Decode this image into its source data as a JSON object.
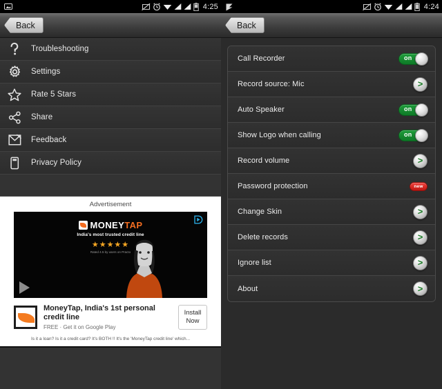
{
  "left_screen": {
    "status_bar": {
      "clock": "4:25",
      "icons": [
        "screenshot-icon",
        "alarm-icon",
        "wifi-icon",
        "signal-icon",
        "signal-2-icon",
        "battery-icon"
      ]
    },
    "action_bar": {
      "back_label": "Back"
    },
    "menu": {
      "items": [
        {
          "label": "Troubleshooting",
          "icon": "question-mark-icon"
        },
        {
          "label": "Settings",
          "icon": "gear-icon"
        },
        {
          "label": "Rate 5 Stars",
          "icon": "star-icon"
        },
        {
          "label": "Share",
          "icon": "share-icon"
        },
        {
          "label": "Feedback",
          "icon": "envelope-icon"
        },
        {
          "label": "Privacy Policy",
          "icon": "document-icon"
        }
      ]
    },
    "advertisement": {
      "label": "Advertisement",
      "brand_primary": "MONEY",
      "brand_secondary": "TAP",
      "tagline": "India's most trusted credit line",
      "stars": "★★★★★",
      "rating_note": "Rated 4.5 by users on Practo",
      "app_title": "MoneyTap, India's 1st personal credit line",
      "app_subtitle": "FREE · Get it on Google Play",
      "install_line1": "Install",
      "install_line2": "Now",
      "description": "Is it a loan? Is it a credit card? It's BOTH !!  It's the 'MoneyTap credit line' which...",
      "adchoices_icon": "adchoices-icon",
      "play_icon": "play-icon"
    }
  },
  "right_screen": {
    "status_bar": {
      "clock": "4:24",
      "icons": [
        "screenshot-icon",
        "alarm-icon",
        "wifi-icon",
        "signal-icon",
        "signal-2-icon",
        "battery-icon"
      ]
    },
    "action_bar": {
      "back_label": "Back"
    },
    "settings": {
      "rows": [
        {
          "label": "Call Recorder",
          "control": "toggle",
          "state": "on"
        },
        {
          "label": "Record source: Mic",
          "control": "arrow",
          "state": ""
        },
        {
          "label": "Auto Speaker",
          "control": "toggle",
          "state": "on"
        },
        {
          "label": "Show Logo when calling",
          "control": "toggle",
          "state": "on"
        },
        {
          "label": "Record volume",
          "control": "arrow",
          "state": ""
        },
        {
          "label": "Password protection",
          "control": "badge",
          "state": "new"
        },
        {
          "label": "Change Skin",
          "control": "arrow",
          "state": ""
        },
        {
          "label": "Delete records",
          "control": "arrow",
          "state": ""
        },
        {
          "label": "Ignore list",
          "control": "arrow",
          "state": ""
        },
        {
          "label": "About",
          "control": "arrow",
          "state": ""
        }
      ]
    }
  },
  "colors": {
    "toggle_on": "#0e7a27",
    "badge_new": "#c01712",
    "arrow_green": "#1a7a25",
    "brand_orange": "#f36d21"
  }
}
